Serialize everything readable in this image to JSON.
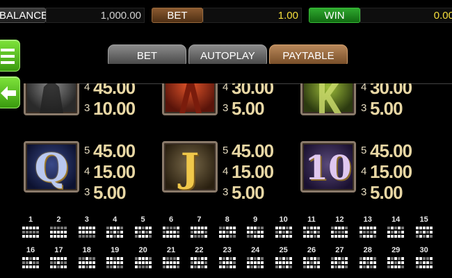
{
  "topbar": {
    "balance_label": "BALANCE",
    "balance_value": "1,000.00",
    "bet_label": "BET",
    "bet_value": "1.00",
    "win_label": "WIN",
    "win_value": "0.00"
  },
  "side_buttons": {
    "menu_icon": "hamburger-menu-icon",
    "back_icon": "back-arrow-icon"
  },
  "tabs": [
    {
      "label": "BET",
      "active": false
    },
    {
      "label": "AUTOPLAY",
      "active": false
    },
    {
      "label": "PAYTABLE",
      "active": true
    }
  ],
  "paytable": {
    "top_row": [
      {
        "symbol": "dark-figure",
        "rows": [
          {
            "count": "4",
            "amount": "45.00"
          },
          {
            "count": "3",
            "amount": "10.00"
          }
        ]
      },
      {
        "symbol": "red-a",
        "rows": [
          {
            "count": "4",
            "amount": "30.00"
          },
          {
            "count": "3",
            "amount": "5.00"
          }
        ]
      },
      {
        "symbol": "green-k",
        "rows": [
          {
            "count": "4",
            "amount": "30.00"
          },
          {
            "count": "3",
            "amount": "5.00"
          }
        ]
      }
    ],
    "bottom_row": [
      {
        "symbol": "Q",
        "rows": [
          {
            "count": "5",
            "amount": "45.00"
          },
          {
            "count": "4",
            "amount": "15.00"
          },
          {
            "count": "3",
            "amount": "5.00"
          }
        ]
      },
      {
        "symbol": "J",
        "rows": [
          {
            "count": "5",
            "amount": "45.00"
          },
          {
            "count": "4",
            "amount": "15.00"
          },
          {
            "count": "3",
            "amount": "5.00"
          }
        ]
      },
      {
        "symbol": "10",
        "rows": [
          {
            "count": "5",
            "amount": "45.00"
          },
          {
            "count": "4",
            "amount": "15.00"
          },
          {
            "count": "3",
            "amount": "5.00"
          }
        ]
      }
    ]
  },
  "paylines": [
    "1",
    "2",
    "3",
    "4",
    "5",
    "6",
    "7",
    "8",
    "9",
    "10",
    "11",
    "12",
    "13",
    "14",
    "15",
    "16",
    "17",
    "18",
    "19",
    "20",
    "21",
    "22",
    "23",
    "24",
    "25",
    "26",
    "27",
    "28",
    "29",
    "30"
  ],
  "colors": {
    "accent_gold": "#e8d7a4",
    "value_yellow": "#f6df3c",
    "win_green": "#2fa82f",
    "bet_brown": "#8a5a30"
  }
}
